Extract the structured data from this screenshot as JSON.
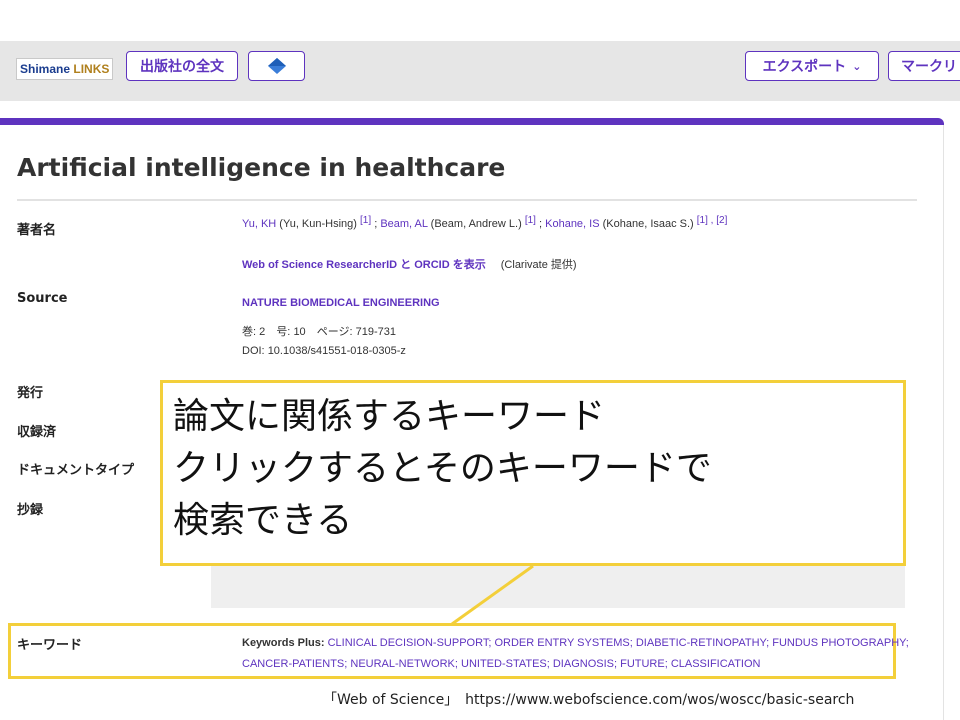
{
  "toolbar": {
    "logo_part1": "Shimane",
    "logo_part2": "LINKS",
    "fulltext_label": "出版社の全文",
    "export_label": "エクスポート",
    "marked_label": "マークリ"
  },
  "record": {
    "title": "Artificial intelligence in healthcare",
    "labels": {
      "authors": "著者名",
      "source": "Source",
      "published": "発行",
      "indexed": "収録済",
      "doctype": "ドキュメントタイプ",
      "abstract": "抄録",
      "keywords": "キーワード"
    },
    "authors": [
      {
        "name": "Yu, KH",
        "full": " (Yu, Kun-Hsing) ",
        "refs": "[1]",
        "sep": " ; "
      },
      {
        "name": "Beam, AL",
        "full": " (Beam, Andrew L.) ",
        "refs": "[1]",
        "sep": " ; "
      },
      {
        "name": "Kohane, IS",
        "full": " (Kohane, Isaac S.) ",
        "refs": "[1] , [2]",
        "sep": ""
      }
    ],
    "researcher_link": "Web of Science ResearcherID と ORCID を表示",
    "researcher_provider": "(Clarivate 提供)",
    "source": {
      "journal": "NATURE BIOMEDICAL ENGINEERING",
      "volume_label": "巻:",
      "volume": "2",
      "issue_label": "号:",
      "issue": "10",
      "pages_label": "ページ:",
      "pages": "719-731",
      "doi_label": "DOI:",
      "doi": "10.1038/s41551-018-0305-z"
    },
    "keywords_label": "Keywords Plus:",
    "keywords_line1": "CLINICAL DECISION-SUPPORT; ORDER ENTRY SYSTEMS; DIABETIC-RETINOPATHY; FUNDUS PHOTOGRAPHY;",
    "keywords_line2": "CANCER-PATIENTS; NEURAL-NETWORK; UNITED-STATES; DIAGNOSIS; FUTURE; CLASSIFICATION"
  },
  "callout": {
    "line1": "論文に関係するキーワード",
    "line2": "クリックするとそのキーワードで",
    "line3": "検索できる"
  },
  "footer": "「Web of Science」　https://www.webofscience.com/wos/woscc/basic-search",
  "colors": {
    "accent": "#5e33bf",
    "highlight": "#f3cf3a",
    "toolbar_bg": "#e6e6e6"
  }
}
